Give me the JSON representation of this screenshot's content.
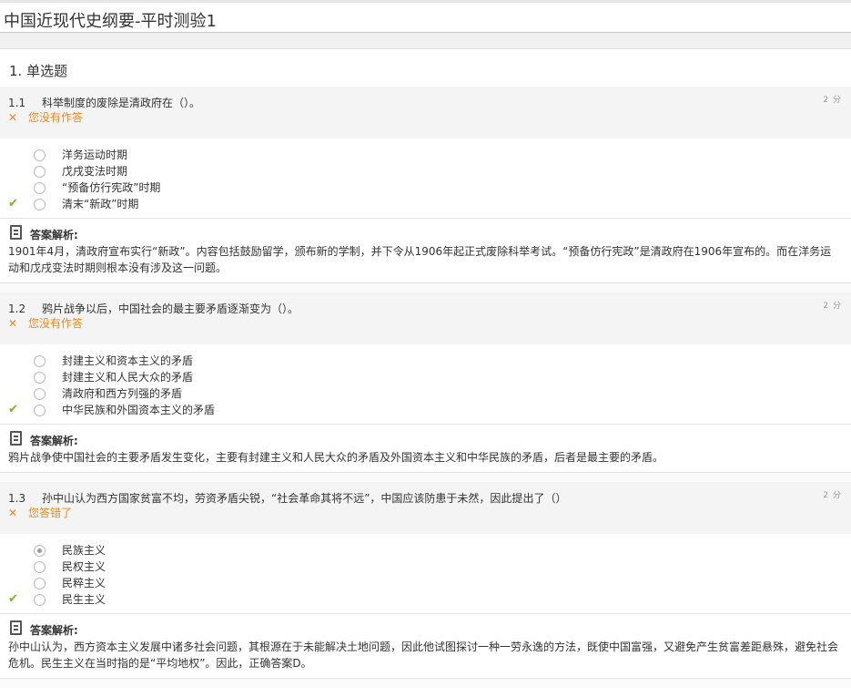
{
  "page": {
    "title": "中国近现代史纲要-平时测验1"
  },
  "section": {
    "title": "1. 单选题"
  },
  "questions": [
    {
      "number": "1.1",
      "text": "科举制度的废除是清政府在（）。",
      "score": "2 分",
      "status": "您没有作答",
      "options": [
        "洋务运动时期",
        "戊戌变法时期",
        "“预备仿行宪政”时期",
        "清末“新政”时期"
      ],
      "correct_index": 3,
      "selected_index": -1,
      "analysis_title": "答案解析:",
      "analysis_text": "1901年4月，清政府宣布实行“新政”。内容包括鼓励留学，颁布新的学制，并下令从1906年起正式废除科举考试。“预备仿行宪政”是清政府在1906年宣布的。而在洋务运动和戊戌变法时期则根本没有涉及这一问题。"
    },
    {
      "number": "1.2",
      "text": "鸦片战争以后，中国社会的最主要矛盾逐渐变为（）。",
      "score": "2 分",
      "status": "您没有作答",
      "options": [
        "封建主义和资本主义的矛盾",
        "封建主义和人民大众的矛盾",
        "清政府和西方列强的矛盾",
        "中华民族和外国资本主义的矛盾"
      ],
      "correct_index": 3,
      "selected_index": -1,
      "analysis_title": "答案解析:",
      "analysis_text": "鸦片战争使中国社会的主要矛盾发生变化，主要有封建主义和人民大众的矛盾及外国资本主义和中华民族的矛盾，后者是最主要的矛盾。"
    },
    {
      "number": "1.3",
      "text": "孙中山认为西方国家贫富不均，劳资矛盾尖锐，“社会革命其将不远”，中国应该防患于未然，因此提出了（）",
      "score": "2 分",
      "status": "您答错了",
      "options": [
        "民族主义",
        "民权主义",
        "民粹主义",
        "民生主义"
      ],
      "correct_index": 3,
      "selected_index": 0,
      "analysis_title": "答案解析:",
      "analysis_text": "孙中山认为，西方资本主义发展中诸多社会问题，其根源在于未能解决土地问题，因此他试图探讨一种一劳永逸的方法，既使中国富强，又避免产生贫富差距悬殊，避免社会危机。民生主义在当时指的是“平均地权”。因此，正确答案D。"
    }
  ],
  "icons": {
    "wrong": "✕",
    "correct": "✔"
  },
  "colors": {
    "status": "#e78a1e",
    "correct_mark": "#7ab51d"
  }
}
